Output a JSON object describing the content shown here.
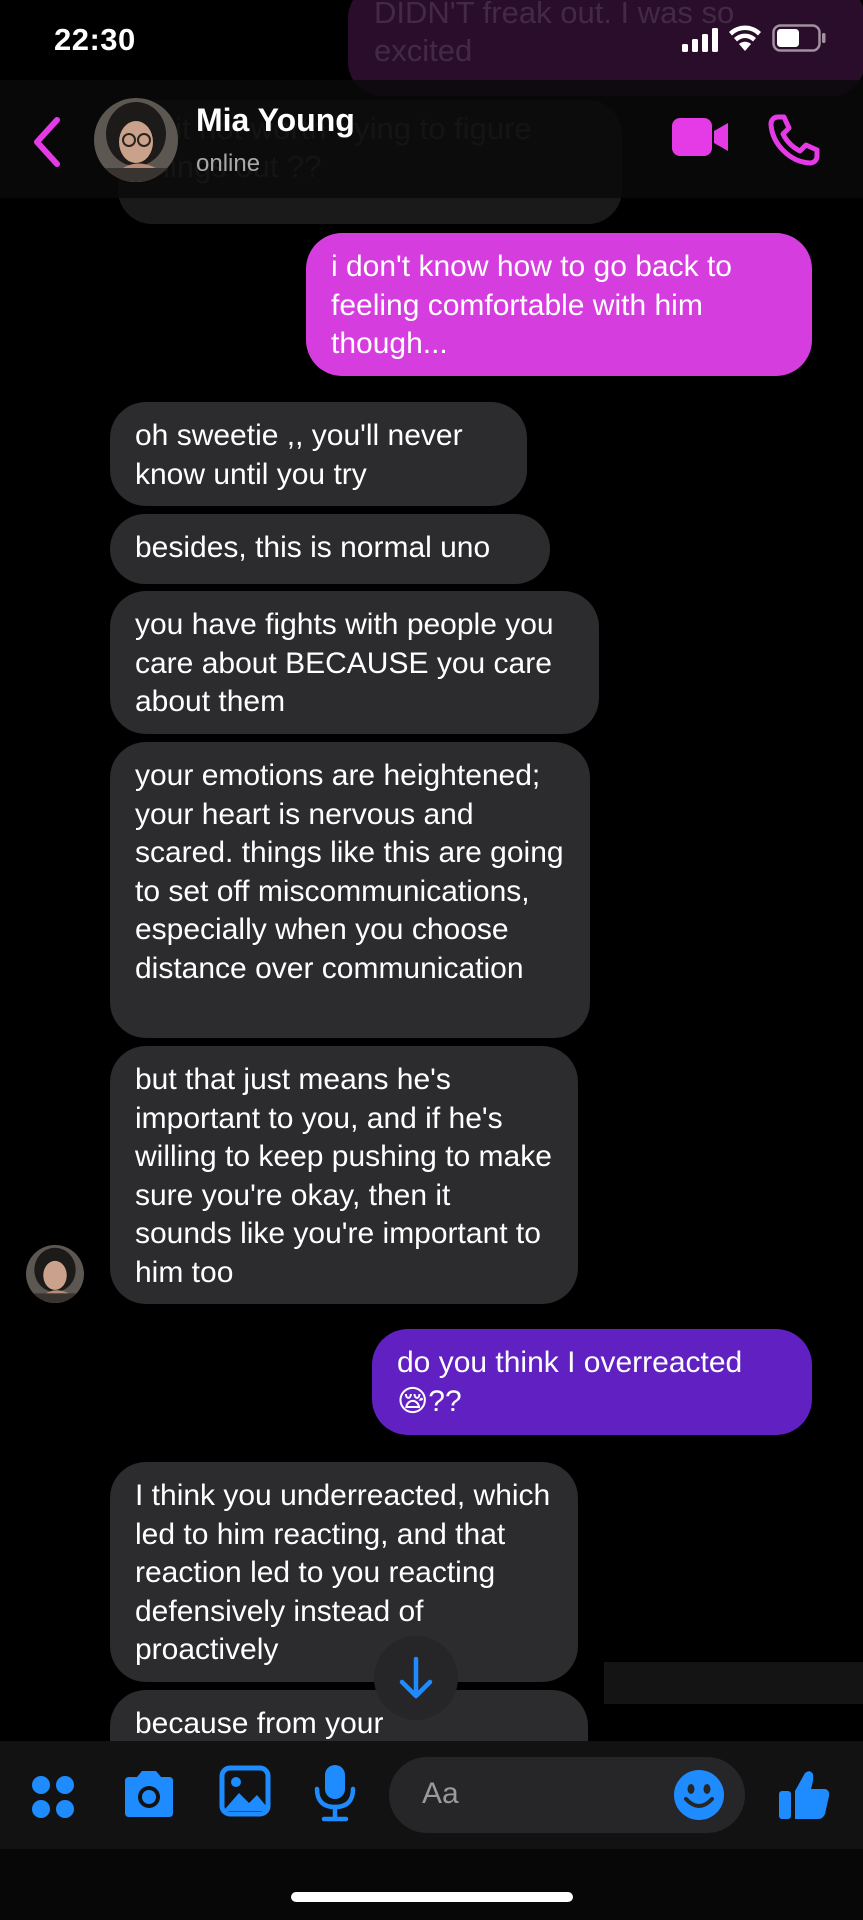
{
  "status_bar": {
    "time": "22:30"
  },
  "header": {
    "name": "Mia Young",
    "status": "online"
  },
  "ghost_messages": [
    "DIDN'T freak out. I was so excited",
    "is it not worth trying to figure things out ??"
  ],
  "messages": [
    {
      "side": "out",
      "text": "i don't know how to go back to feeling comfortable with him though..."
    },
    {
      "side": "in",
      "text": "oh sweetie ,, you'll never know until you try"
    },
    {
      "side": "in",
      "text": "besides, this is normal uno"
    },
    {
      "side": "in",
      "text": "you have fights with people you care about BECAUSE you care about them"
    },
    {
      "side": "in",
      "text": "your emotions are heightened; your heart is nervous and scared. things like this are going to set off miscommunications, especially when you choose distance over communication"
    },
    {
      "side": "in",
      "text": "but that just means he's important to you, and if he's willing to keep pushing to make sure you're okay, then it sounds like you're important to him too"
    },
    {
      "side": "out",
      "text": "do you think I overreacted 😪??"
    },
    {
      "side": "in",
      "text": "I think you underreacted, which led to him reacting, and that reaction led to you reacting defensively instead of proactively"
    },
    {
      "side": "in",
      "text": "because from your"
    }
  ],
  "composer": {
    "placeholder": "Aa"
  },
  "colors": {
    "accent": "#e53be6",
    "out_bubble_1": "#d63ddf",
    "out_bubble_2": "#6020c2",
    "in_bubble": "#2c2c2e",
    "composer_icons": "#1e8cff"
  },
  "icons": [
    "back-chevron-icon",
    "video-call-icon",
    "phone-call-icon",
    "apps-icon",
    "camera-icon",
    "gallery-icon",
    "microphone-icon",
    "emoji-icon",
    "thumbs-up-icon",
    "scroll-down-arrow-icon"
  ]
}
